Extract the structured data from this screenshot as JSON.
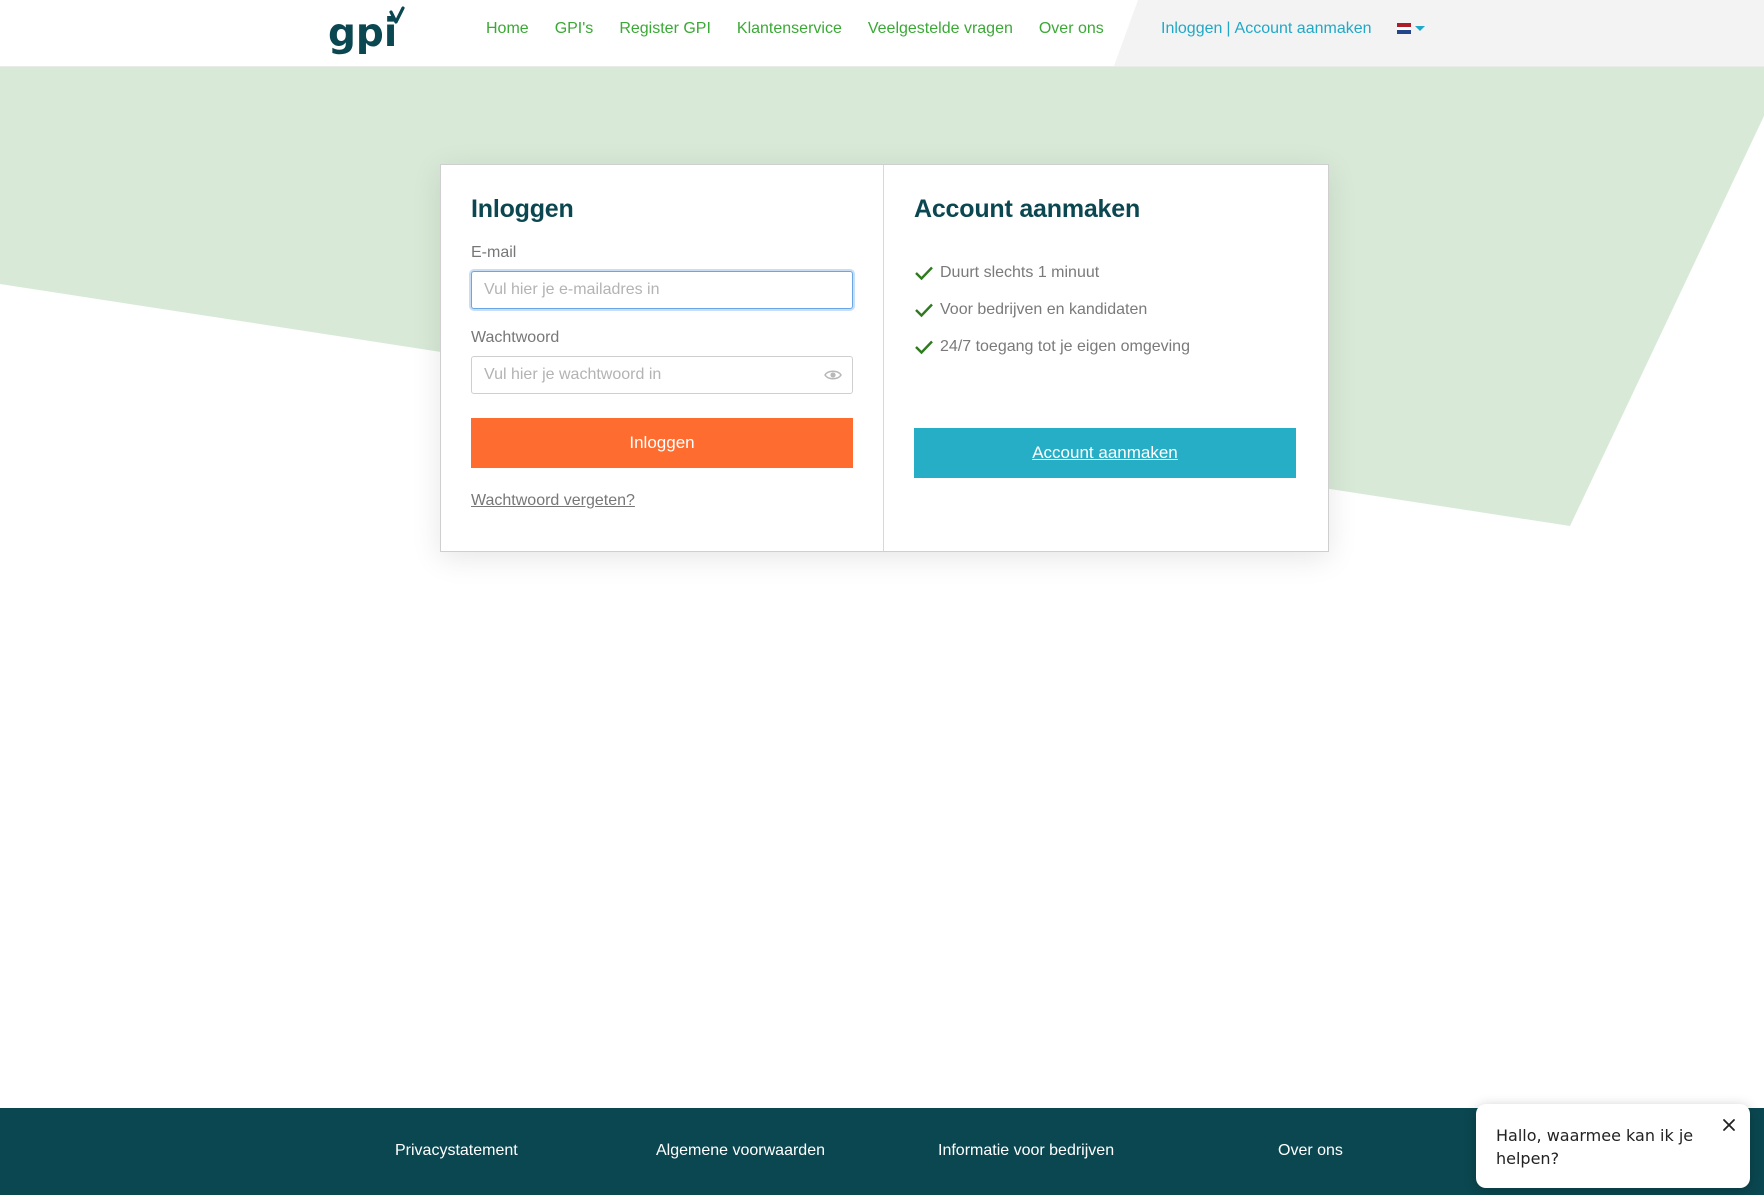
{
  "header": {
    "logo_text": "gpi",
    "nav": [
      "Home",
      "GPI's",
      "Register GPI",
      "Klantenservice",
      "Veelgestelde vragen",
      "Over ons"
    ],
    "account": {
      "login": "Inloggen",
      "separator": "|",
      "create": "Account aanmaken"
    },
    "language": {
      "icon": "flag-netherlands-icon",
      "colors": [
        "#ae1c28",
        "#ffffff",
        "#21468b"
      ]
    }
  },
  "login": {
    "title": "Inloggen",
    "email_label": "E-mail",
    "email_placeholder": "Vul hier je e-mailadres in",
    "email_value": "",
    "password_label": "Wachtwoord",
    "password_placeholder": "Vul hier je wachtwoord in",
    "password_value": "",
    "submit_label": "Inloggen",
    "forgot_label": "Wachtwoord vergeten?"
  },
  "register": {
    "title": "Account aanmaken",
    "benefits": [
      "Duurt slechts 1 minuut",
      "Voor bedrijven en kandidaten",
      "24/7 toegang tot je eigen omgeving"
    ],
    "button_label": "Account aanmaken"
  },
  "footer": {
    "links": [
      "Privacystatement",
      "Algemene voorwaarden",
      "Informatie voor bedrijven",
      "Over ons"
    ]
  },
  "chat": {
    "message": "Hallo, waarmee kan ik je helpen?"
  },
  "colors": {
    "primary_dark": "#0b4750",
    "nav_green": "#3aa935",
    "link_teal": "#21a8c7",
    "login_orange": "#ff6c2f",
    "register_teal": "#25aec6",
    "hero_green": "#d8ead7"
  }
}
